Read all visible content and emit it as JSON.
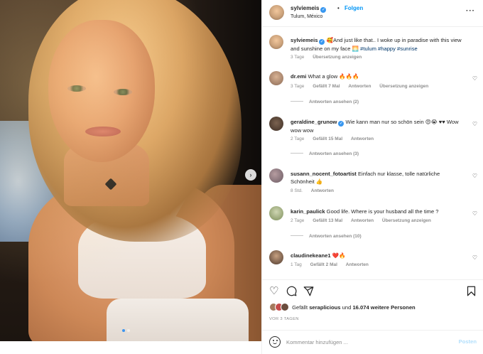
{
  "post": {
    "username": "sylviemeis",
    "follow_label": "Folgen",
    "separator": "•",
    "location": "Tulum, México",
    "more_label": "···"
  },
  "media": {
    "next_label": "›",
    "dots": 2
  },
  "caption": {
    "username": "sylviemeis",
    "text": "🥰And just like that.. I woke up in paradise with this view and sunshine on my face 🌅",
    "tags": "#tulum #happy #sunrise",
    "time": "3 Tage",
    "translate": "Übersetzung anzeigen"
  },
  "comments": [
    {
      "username": "dr.emi",
      "verified": false,
      "text": "What a glow 🔥🔥🔥",
      "time": "3 Tage",
      "likes": "Gefällt 7 Mal",
      "reply": "Antworten",
      "translate": "Übersetzung anzeigen",
      "replies": "Antworten ansehen (2)"
    },
    {
      "username": "geraldine_grunow",
      "verified": true,
      "text": "Wie kann man nur so schön sein 😍😭 ♥♥ Wow wow wow",
      "time": "2 Tage",
      "likes": "Gefällt 15 Mal",
      "reply": "Antworten",
      "translate": "",
      "replies": "Antworten ansehen (3)"
    },
    {
      "username": "susann_nocent_fotoartist",
      "verified": false,
      "text": "Einfach nur klasse, tolle natürliche Schönheit 👍",
      "time": "8 Std.",
      "likes": "",
      "reply": "Antworten",
      "translate": "",
      "replies": ""
    },
    {
      "username": "karin_paulick",
      "verified": false,
      "text": "Good life. Where is your husband all the time ?",
      "time": "2 Tage",
      "likes": "Gefällt 13 Mal",
      "reply": "Antworten",
      "translate": "Übersetzung anzeigen",
      "replies": "Antworten ansehen (10)"
    },
    {
      "username": "claudinekeane1",
      "verified": false,
      "text": "❤️🔥",
      "time": "1 Tag",
      "likes": "Gefällt 2 Mal",
      "reply": "Antworten",
      "translate": "",
      "replies": ""
    }
  ],
  "actions": {
    "like_icon": "heart-outline-icon",
    "comment_icon": "comment-icon",
    "share_icon": "share-icon",
    "save_icon": "bookmark-icon"
  },
  "likes_line": {
    "prefix": "Gefällt",
    "user": "seraplicious",
    "connector": "und",
    "count": "16.074 weitere Personen"
  },
  "post_age": "VOR 3 TAGEN",
  "comment_box": {
    "placeholder": "Kommentar hinzufügen ...",
    "post_label": "Posten"
  },
  "colors": {
    "accent": "#0095f6",
    "verified": "#3897f0",
    "muted": "#8e8e8e",
    "tag": "#00376b"
  }
}
